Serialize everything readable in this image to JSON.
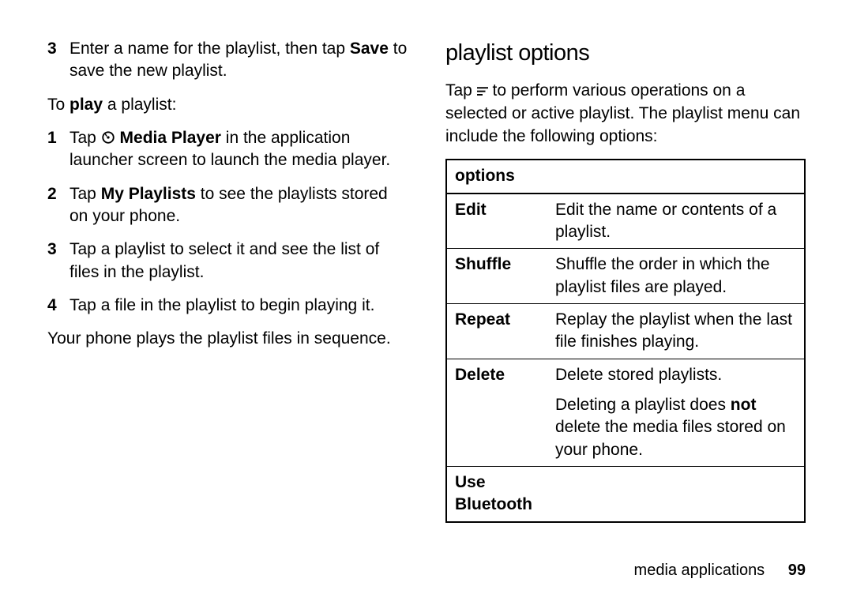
{
  "left": {
    "step3_num": "3",
    "step3_a": "Enter a name for the playlist, then tap ",
    "step3_save": "Save",
    "step3_b": " to save the new playlist.",
    "intro_a": "To ",
    "intro_play": "play",
    "intro_b": " a playlist:",
    "p1_num": "1",
    "p1_a": "Tap ",
    "p1_mp": " Media Player",
    "p1_b": " in the application launcher screen to launch the media player.",
    "p2_num": "2",
    "p2_a": "Tap ",
    "p2_myp": "My Playlists",
    "p2_b": " to see the playlists stored on your phone.",
    "p3_num": "3",
    "p3": "Tap a playlist to select it and see the list of files in the playlist.",
    "p4_num": "4",
    "p4": "Tap a file in the playlist to begin playing it.",
    "outro": "Your phone plays the playlist files in sequence."
  },
  "right": {
    "heading": "playlist options",
    "intro_a": "Tap ",
    "intro_b": " to perform various operations on a selected or active playlist. The playlist menu can include the following options:",
    "table_header": "options",
    "rows": {
      "edit_label": "Edit",
      "edit_desc": "Edit the name or contents of a playlist.",
      "shuffle_label": "Shuffle",
      "shuffle_desc": "Shuffle the order in which the playlist files are played.",
      "repeat_label": "Repeat",
      "repeat_desc": "Replay the playlist when the last file finishes playing.",
      "delete_label": "Delete",
      "delete_desc1": "Delete stored playlists.",
      "delete_desc2a": "Deleting a playlist does ",
      "delete_not": "not",
      "delete_desc2b": " delete the media files stored on your phone.",
      "bt_label": "Use Bluetooth",
      "bt_desc": ""
    }
  },
  "footer": {
    "section": "media applications",
    "page": "99"
  }
}
